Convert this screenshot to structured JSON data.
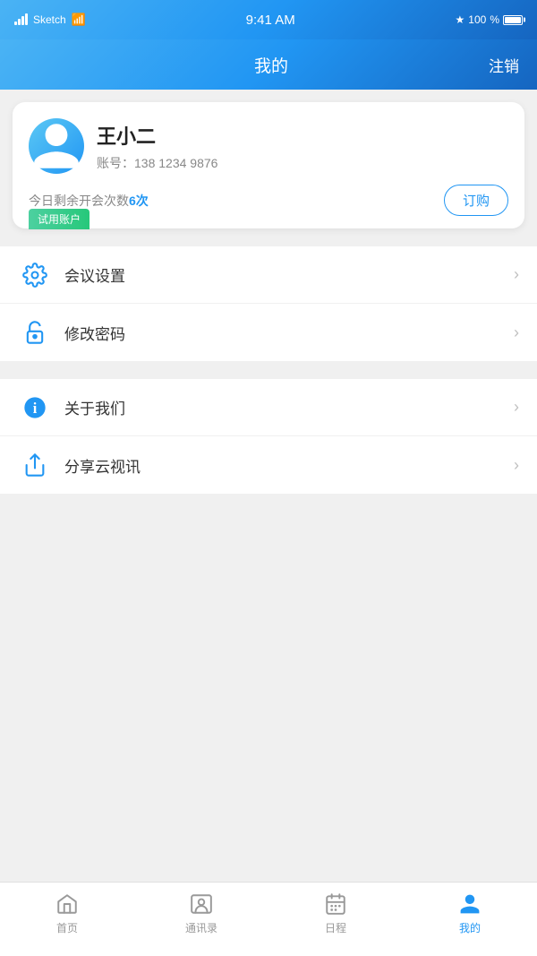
{
  "statusBar": {
    "carrier": "Sketch",
    "wifi": true,
    "time": "9:41 AM",
    "bluetooth": "100%",
    "battery": 100
  },
  "navBar": {
    "title": "我的",
    "action": "注销"
  },
  "profile": {
    "name": "王小二",
    "accountLabel": "账号：",
    "accountNumber": "138 1234 9876",
    "meetingInfoPrefix": "今日剩余开会次数",
    "meetingCount": "6次",
    "subscribeLabel": "订购",
    "trialBadge": "试用账户"
  },
  "menuItems": [
    {
      "id": "settings",
      "label": "会议设置",
      "iconType": "gear"
    },
    {
      "id": "password",
      "label": "修改密码",
      "iconType": "lock"
    },
    {
      "id": "about",
      "label": "关于我们",
      "iconType": "info"
    },
    {
      "id": "share",
      "label": "分享云视讯",
      "iconType": "share"
    }
  ],
  "tabBar": {
    "items": [
      {
        "id": "home",
        "label": "首页",
        "active": false
      },
      {
        "id": "contacts",
        "label": "通讯录",
        "active": false
      },
      {
        "id": "calendar",
        "label": "日程",
        "active": false
      },
      {
        "id": "mine",
        "label": "我的",
        "active": true
      }
    ]
  }
}
